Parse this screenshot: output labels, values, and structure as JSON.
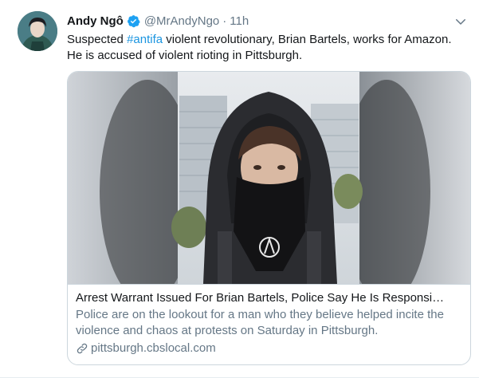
{
  "tweet": {
    "author_name": "Andy Ngô",
    "handle": "@MrAndyNgo",
    "separator": "·",
    "time": "11h",
    "text_before": "Suspected ",
    "hashtag": "#antifa",
    "text_after": " violent revolutionary, Brian Bartels, works for Amazon. He is accused of violent rioting in Pittsburgh."
  },
  "card": {
    "title": "Arrest Warrant Issued For Brian Bartels, Police Say He Is Responsi…",
    "description": "Police are on the lookout for a man who they believe helped incite the violence and chaos at protests on Saturday in Pittsburgh.",
    "domain": "pittsburgh.cbslocal.com"
  },
  "colors": {
    "link_blue": "#1b95e0",
    "secondary_text": "#657786",
    "border": "#ccd6dd"
  },
  "icons": {
    "verified": "verified-badge-icon",
    "caret": "chevron-down-icon",
    "link": "link-icon"
  }
}
